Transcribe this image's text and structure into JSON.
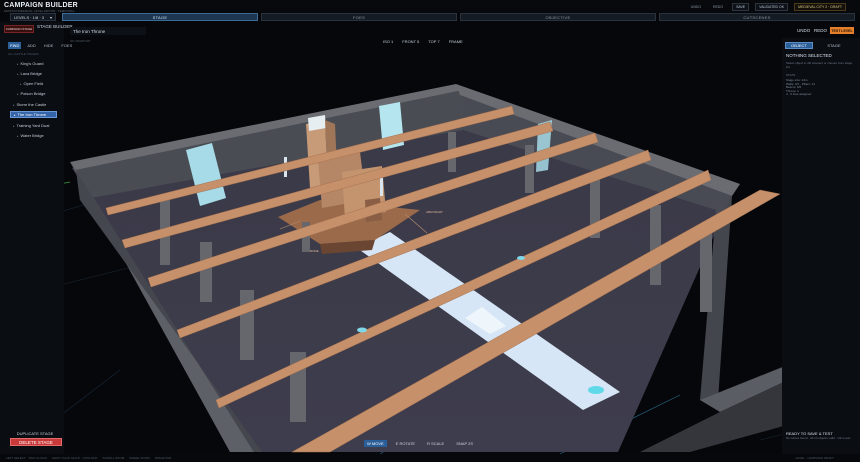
{
  "app": {
    "title": "CAMPAIGN BUILDER",
    "subtitle": "FANTASY/MEDIEVAL LEVEL EDITOR · TEMPORAL"
  },
  "topbar": {
    "items": [
      "UNDO",
      "REDO",
      "SAVE",
      "VALIDATED OK",
      "MEDIEVAL CITY 2 · DRAFT"
    ]
  },
  "tabs": {
    "levels": "LEVELS · 1/8 · 3",
    "items": [
      "STAGE",
      "FOES",
      "OBJECTIVE",
      "CUTSCENES"
    ],
    "active": "STAGE"
  },
  "left": {
    "stage_pill": "CAMPAIGN STAGE",
    "stage_builder": "STAGE BUILDER",
    "mini_tabs": [
      "FIND",
      "ADD",
      "HIDE",
      "FOES"
    ],
    "section_label": "ALL CASTLE STAGES",
    "items": [
      "King's Guard",
      "Lava Bridge",
      "Open Field",
      "Poison Bridge",
      "Storm the Castle",
      "The Iron Throne",
      "Training Yard Dual",
      "Water Bridge"
    ],
    "active_item": "The Iron Throne",
    "duplicate": "DUPLICATE STAGE",
    "delete": "DELETE STAGE"
  },
  "viewport": {
    "title": "The Iron Throne",
    "sub": "3D VIEWPORT",
    "views": [
      "ISO 1",
      "FRONT 5",
      "TOP 7",
      "FRAME"
    ],
    "undo": "UNDO",
    "redo": "REDO",
    "test": "TEST LEVEL",
    "labels": [
      "ARM RIGHT",
      "SEAT",
      "THRONE"
    ]
  },
  "right": {
    "tabs": [
      "OBJECT",
      "STAGE"
    ],
    "title": "NOTHING SELECTED",
    "desc": "Select object in 3D viewport or choose from stage list.",
    "stats_label": "STATS",
    "stats": [
      "Stage size: 24m",
      "Walls: 4/4 · Pillars: 14",
      "Beams: 6/6",
      "Throne: 1",
      "4 · 0 foes assigned"
    ],
    "ready": "READY TO SAVE & TEST",
    "ready_sub": "No issues found · All 14 objects valid · Ok to test"
  },
  "tools": {
    "items": [
      "W MOVE",
      "E ROTATE",
      "R SCALE",
      "SNAP 2S"
    ],
    "active": "W MOVE"
  },
  "status": {
    "items": [
      "LEFT SELECT · TWO CLICKS",
      "SHIFT CLICK MULTI · CTRL DUP",
      "SCROLL ZOOM",
      "WHEEL ZOOM",
      "SPACE PAN"
    ],
    "right": "LEVEL · CAMPAIGN DRAFT"
  },
  "colors": {
    "accent": "#2b5f9a",
    "danger": "#c83a3a",
    "test": "#e57f2a",
    "floor": "#3a3a4a",
    "wall": "#55585e",
    "beam": "#c88e68"
  }
}
